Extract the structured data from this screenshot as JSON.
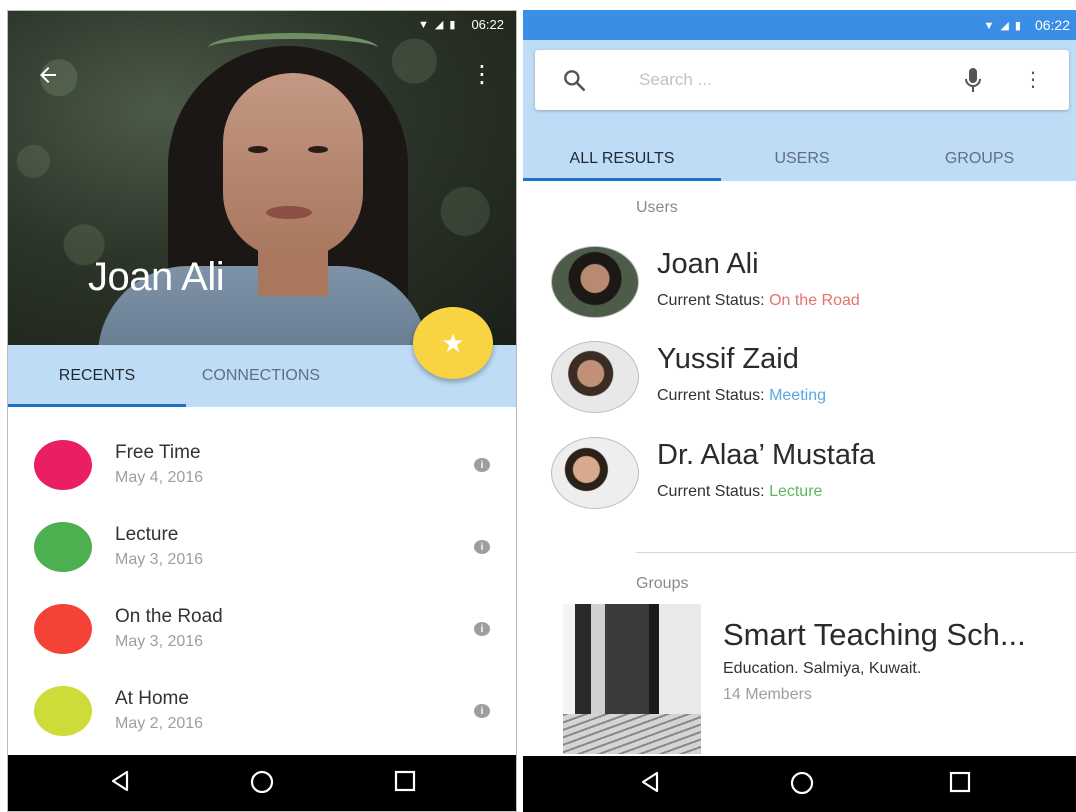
{
  "left_screen": {
    "status_time": "06:22",
    "profile_name": "Joan Ali",
    "tabs": [
      {
        "label": "RECENTS",
        "active": true
      },
      {
        "label": "CONNECTIONS",
        "active": false
      }
    ],
    "fab_icon": "star-icon",
    "recents": [
      {
        "title": "Free Time",
        "date": "May 4, 2016",
        "color": "#e91e63"
      },
      {
        "title": "Lecture",
        "date": "May 3, 2016",
        "color": "#4caf50"
      },
      {
        "title": "On the Road",
        "date": "May 3, 2016",
        "color": "#f44336"
      },
      {
        "title": "At Home",
        "date": "May 2, 2016",
        "color": "#cddc39"
      }
    ]
  },
  "right_screen": {
    "status_time": "06:22",
    "search": {
      "placeholder": "Search ..."
    },
    "tabs": [
      {
        "label": "ALL RESULTS",
        "active": true
      },
      {
        "label": "USERS",
        "active": false
      },
      {
        "label": "GROUPS",
        "active": false
      }
    ],
    "users_section_label": "Users",
    "status_prefix": "Current Status:",
    "users": [
      {
        "name": "Joan Ali",
        "status": "On the Road",
        "status_color": "#e57368"
      },
      {
        "name": "Yussif Zaid",
        "status": "Meeting",
        "status_color": "#5aa7e0"
      },
      {
        "name": "Dr. Alaa’ Mustafa",
        "status": "Lecture",
        "status_color": "#5cb85c"
      }
    ],
    "groups_section_label": "Groups",
    "group": {
      "name": "Smart Teaching Sch...",
      "location": "Education. Salmiya, Kuwait.",
      "members": "14 Members"
    }
  },
  "colors": {
    "accent_blue": "#1e73c8",
    "tab_background": "#bfdcf7",
    "fab_yellow": "#f8d443",
    "status_bar_blue": "#3a8ee6"
  }
}
